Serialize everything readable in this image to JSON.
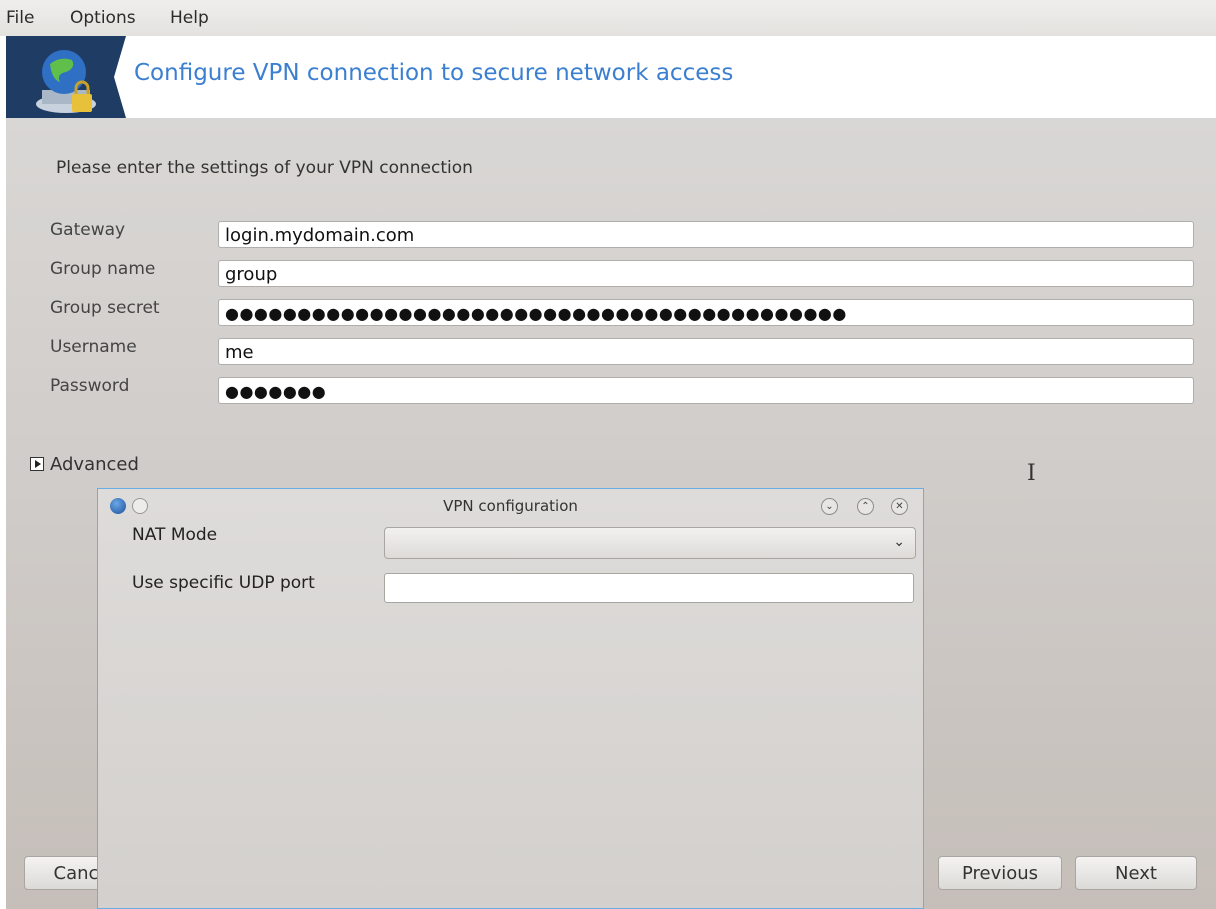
{
  "menubar": {
    "file": "File",
    "options": "Options",
    "help": "Help"
  },
  "header": {
    "title": "Configure VPN connection to secure network access"
  },
  "form": {
    "subtitle": "Please enter the settings of your VPN connection",
    "fields": [
      {
        "label": "Gateway",
        "value": "login.mydomain.com"
      },
      {
        "label": "Group name",
        "value": "group"
      },
      {
        "label": "Group secret",
        "value": "●●●●●●●●●●●●●●●●●●●●●●●●●●●●●●●●●●●●●●●●●●●"
      },
      {
        "label": "Username",
        "value": "me"
      },
      {
        "label": "Password",
        "value": "●●●●●●●"
      }
    ],
    "advanced": "Advanced"
  },
  "buttons": {
    "cancel": "Cancel",
    "previous": "Previous",
    "next": "Next"
  },
  "dialog": {
    "title": "VPN configuration",
    "nat_mode_label": "NAT Mode",
    "nat_mode_value": "",
    "udp_port_label": "Use specific UDP port",
    "udp_port_value": ""
  },
  "colors": {
    "accent": "#3b7fd1",
    "header_logo_bg": "#1e3c64",
    "dialog_border": "#6aaee6"
  },
  "icons": [
    "network-globe-icon",
    "dialog-app-icon",
    "minimize-icon",
    "maximize-icon",
    "close-icon",
    "dropdown-chevron-icon",
    "expander-arrow-icon",
    "text-cursor-icon"
  ]
}
